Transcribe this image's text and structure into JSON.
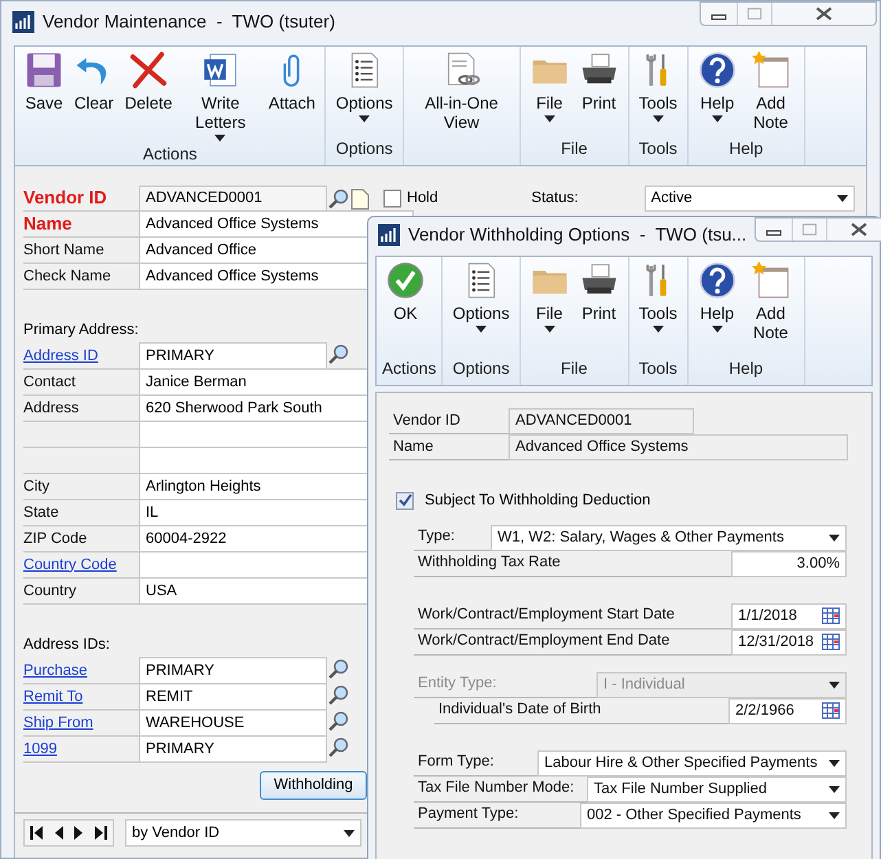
{
  "main_window": {
    "title": "Vendor Maintenance  -  TWO (tsuter)",
    "ribbon": [
      {
        "label": "Actions",
        "buttons": [
          {
            "kind": "save",
            "label": "Save",
            "dropdown": false
          },
          {
            "kind": "clear",
            "label": "Clear",
            "dropdown": false
          },
          {
            "kind": "delete",
            "label": "Delete",
            "dropdown": false
          },
          {
            "kind": "word",
            "label": "Write Letters",
            "dropdown": true
          },
          {
            "kind": "attach",
            "label": "Attach",
            "dropdown": false
          }
        ]
      },
      {
        "label": "Options",
        "buttons": [
          {
            "kind": "options",
            "label": "Options",
            "dropdown": true
          }
        ]
      },
      {
        "buttons": [
          {
            "kind": "aio",
            "label": "All-in-One View",
            "dropdown": false
          }
        ]
      },
      {
        "label": "File",
        "buttons": [
          {
            "kind": "file",
            "label": "File",
            "dropdown": true
          },
          {
            "kind": "print",
            "label": "Print",
            "dropdown": false
          }
        ]
      },
      {
        "label": "Tools",
        "buttons": [
          {
            "kind": "tools",
            "label": "Tools",
            "dropdown": true
          }
        ]
      },
      {
        "label": "Help",
        "buttons": [
          {
            "kind": "help",
            "label": "Help",
            "dropdown": true
          },
          {
            "kind": "note",
            "label": "Add Note",
            "dropdown": false
          }
        ]
      }
    ],
    "vendor_id": {
      "label": "Vendor ID",
      "value": "ADVANCED0001"
    },
    "hold": {
      "label": "Hold",
      "checked": false
    },
    "status": {
      "label": "Status:",
      "value": "Active"
    },
    "name_rows": [
      {
        "label": "Name",
        "kind": "required",
        "value": "Advanced Office Systems",
        "lookup": false
      },
      {
        "label": "Short Name",
        "kind": "plain",
        "value": "Advanced Office",
        "lookup": false
      },
      {
        "label": "Check Name",
        "kind": "plain",
        "value": "Advanced Office Systems",
        "lookup": false
      }
    ],
    "primary_address": {
      "heading": "Primary Address:",
      "rows": [
        {
          "label": "Address ID",
          "kind": "link",
          "value": "PRIMARY",
          "lookup": true
        },
        {
          "label": "Contact",
          "kind": "plain",
          "value": "Janice Berman",
          "lookup": false
        },
        {
          "label": "Address",
          "kind": "plain",
          "value": "620 Sherwood Park South",
          "lookup": false
        },
        {
          "lookup": false
        },
        {
          "lookup": false
        },
        {
          "label": "City",
          "kind": "plain",
          "value": "Arlington Heights",
          "lookup": false
        },
        {
          "label": "State",
          "kind": "plain",
          "value": "IL",
          "lookup": false
        },
        {
          "label": "ZIP Code",
          "kind": "plain",
          "value": "60004-2922",
          "lookup": false
        },
        {
          "label": "Country Code",
          "kind": "link",
          "lookup": false
        },
        {
          "label": "Country",
          "kind": "plain",
          "value": "USA",
          "lookup": false
        }
      ]
    },
    "address_ids": {
      "heading": "Address IDs:",
      "rows": [
        {
          "label": "Purchase",
          "kind": "link",
          "value": "PRIMARY",
          "lookup": true
        },
        {
          "label": "Remit To",
          "kind": "link",
          "value": "REMIT",
          "lookup": true
        },
        {
          "label": "Ship From",
          "kind": "link",
          "value": "WAREHOUSE",
          "lookup": true
        },
        {
          "label": "1099",
          "kind": "link",
          "value": "PRIMARY",
          "lookup": true
        }
      ]
    },
    "withholding_button": "Withholding",
    "sort_by": "by Vendor ID"
  },
  "dialog": {
    "title": "Vendor Withholding Options  -  TWO (tsu...",
    "ribbon": [
      {
        "label": "Actions",
        "buttons": [
          {
            "kind": "ok",
            "label": "OK",
            "dropdown": false
          }
        ]
      },
      {
        "label": "Options",
        "buttons": [
          {
            "kind": "options",
            "label": "Options",
            "dropdown": true
          }
        ]
      },
      {
        "label": "File",
        "buttons": [
          {
            "kind": "file",
            "label": "File",
            "dropdown": true
          },
          {
            "kind": "print",
            "label": "Print",
            "dropdown": false
          }
        ]
      },
      {
        "label": "Tools",
        "buttons": [
          {
            "kind": "tools",
            "label": "Tools",
            "dropdown": true
          }
        ]
      },
      {
        "label": "Help",
        "buttons": [
          {
            "kind": "help",
            "label": "Help",
            "dropdown": true
          },
          {
            "kind": "note",
            "label": "Add Note",
            "dropdown": false
          }
        ]
      }
    ],
    "vendor_id": {
      "label": "Vendor ID",
      "value": "ADVANCED0001"
    },
    "name": {
      "label": "Name",
      "value": "Advanced Office Systems"
    },
    "subject": {
      "label": "Subject To Withholding Deduction",
      "checked": true
    },
    "type": {
      "label": "Type:",
      "value": "W1, W2: Salary, Wages & Other Payments"
    },
    "tax_rate": {
      "label": "Withholding Tax Rate",
      "value": "3.00%"
    },
    "start_date": {
      "label": "Work/Contract/Employment Start Date",
      "value": "1/1/2018"
    },
    "end_date": {
      "label": "Work/Contract/Employment End Date",
      "value": "12/31/2018"
    },
    "entity_type": {
      "label": "Entity Type:",
      "value": "I - Individual",
      "disabled": true
    },
    "birth_date": {
      "label": "Individual's Date of Birth",
      "value": "2/2/1966"
    },
    "form_type": {
      "label": "Form Type:",
      "value": "Labour Hire & Other Specified Payments"
    },
    "tfn_mode": {
      "label": "Tax File Number Mode:",
      "value": "Tax File Number Supplied"
    },
    "payment_type": {
      "label": "Payment Type:",
      "value": "002 - Other Specified Payments"
    }
  }
}
